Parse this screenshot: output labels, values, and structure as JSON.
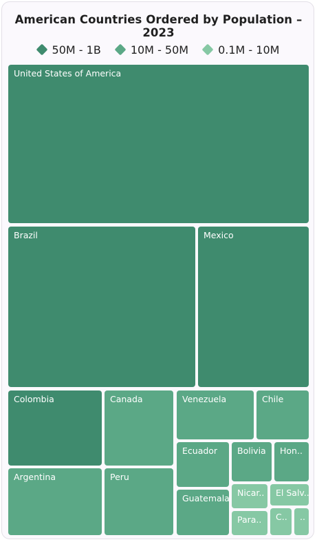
{
  "chart_data": {
    "type": "treemap",
    "title": "American Countries Ordered by Population – 2023",
    "legend": [
      {
        "label": "50M - 1B",
        "color": "#3f8b6e"
      },
      {
        "label": "10M - 50M",
        "color": "#5ba886"
      },
      {
        "label": "0.1M - 10M",
        "color": "#86c8a4"
      }
    ],
    "tiles": [
      {
        "label": "United States of America",
        "group": 0
      },
      {
        "label": "Brazil",
        "group": 0
      },
      {
        "label": "Mexico",
        "group": 0
      },
      {
        "label": "Colombia",
        "group": 0
      },
      {
        "label": "Canada",
        "group": 1
      },
      {
        "label": "Venezuela",
        "group": 1
      },
      {
        "label": "Chile",
        "group": 1
      },
      {
        "label": "Argentina",
        "group": 1
      },
      {
        "label": "Peru",
        "group": 1
      },
      {
        "label": "Ecuador",
        "group": 1
      },
      {
        "label": "Bolivia",
        "group": 1
      },
      {
        "label": "Hon..",
        "group": 1
      },
      {
        "label": "Guatemala",
        "group": 1
      },
      {
        "label": "Nicar..",
        "group": 2
      },
      {
        "label": "El Salv..",
        "group": 2
      },
      {
        "label": "Para..",
        "group": 2
      },
      {
        "label": "C..",
        "group": 2
      },
      {
        "label": "..",
        "group": 2
      }
    ]
  }
}
